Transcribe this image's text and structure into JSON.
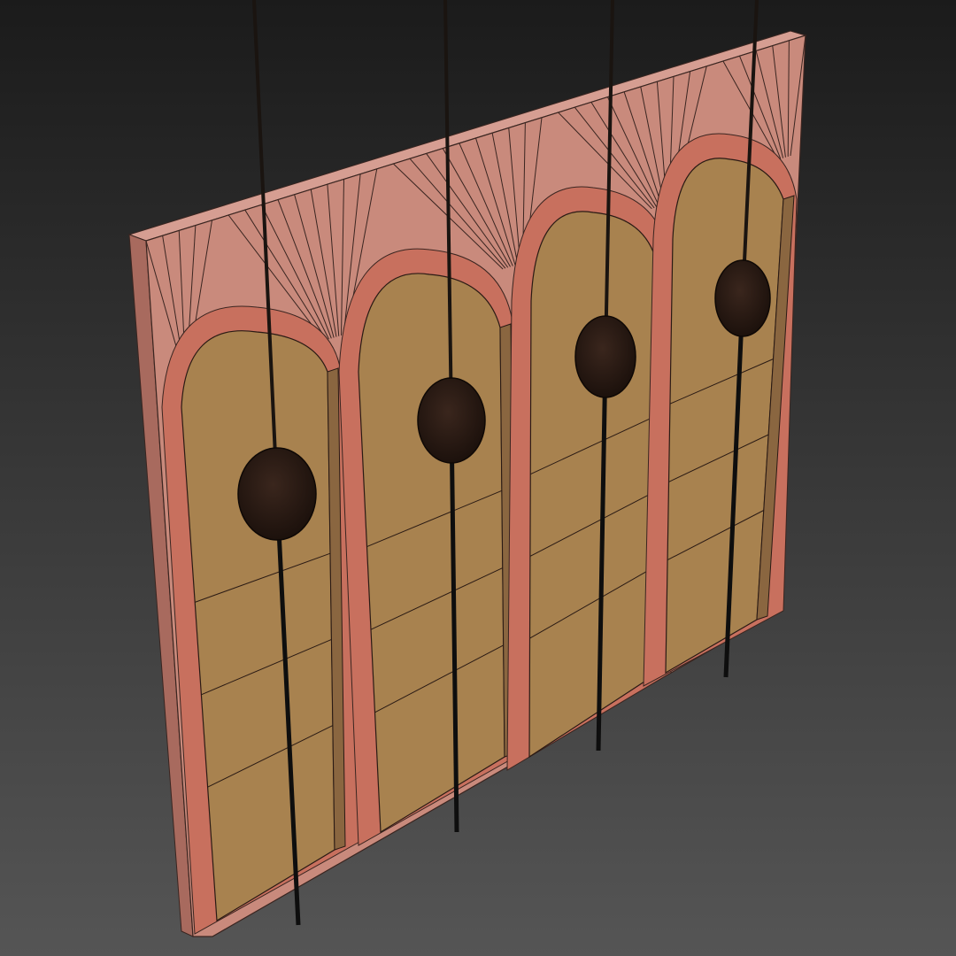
{
  "scene": {
    "background_top_color": "#1b1b1b",
    "background_bottom_color": "#555555",
    "panel_frame_color": "#c98a7c",
    "panel_top_edge_color": "#d69e92",
    "panel_side_color": "#a86a5e",
    "niche_fill_color": "#a8824f",
    "niche_side_color": "#8a6640",
    "arch_trim_color": "#c8705e",
    "sphere_color": "#2a1a14",
    "hanger_rod_color": "#0e0e0e",
    "wire_color": "#1a1410"
  },
  "objects": {
    "panel": {
      "icon": "arched-wall-panel",
      "arch_count": 4
    },
    "spheres": [
      {
        "icon": "hanging-sphere"
      },
      {
        "icon": "hanging-sphere"
      },
      {
        "icon": "hanging-sphere"
      },
      {
        "icon": "hanging-sphere"
      }
    ]
  }
}
